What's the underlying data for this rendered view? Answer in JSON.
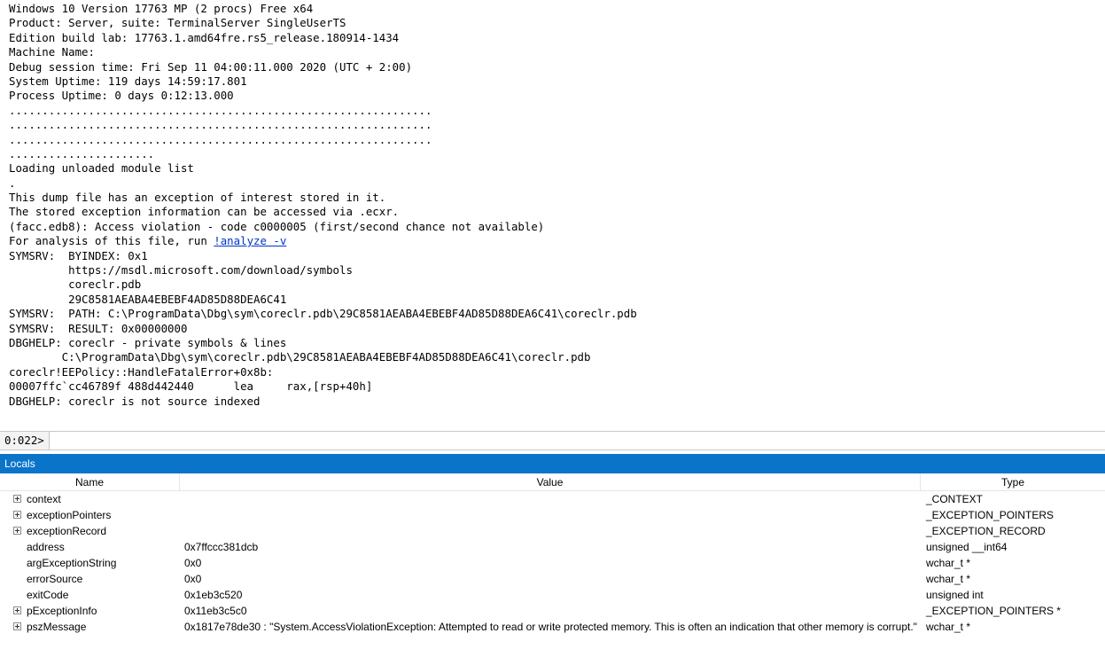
{
  "console": {
    "lines": [
      {
        "t": "Windows 10 Version 17763 MP (2 procs) Free x64"
      },
      {
        "t": "Product: Server, suite: TerminalServer SingleUserTS"
      },
      {
        "t": "Edition build lab: 17763.1.amd64fre.rs5_release.180914-1434"
      },
      {
        "t": "Machine Name:"
      },
      {
        "t": "Debug session time: Fri Sep 11 04:00:11.000 2020 (UTC + 2:00)"
      },
      {
        "t": "System Uptime: 119 days 14:59:17.801"
      },
      {
        "t": "Process Uptime: 0 days 0:12:13.000"
      },
      {
        "t": "................................................................"
      },
      {
        "t": "................................................................"
      },
      {
        "t": "................................................................"
      },
      {
        "t": "......................"
      },
      {
        "t": "Loading unloaded module list"
      },
      {
        "t": "."
      },
      {
        "t": "This dump file has an exception of interest stored in it."
      },
      {
        "t": "The stored exception information can be accessed via .ecxr."
      },
      {
        "t": "(facc.edb8): Access violation - code c0000005 (first/second chance not available)"
      },
      {
        "t": "For analysis of this file, run ",
        "link": "!analyze -v"
      },
      {
        "t": "SYMSRV:  BYINDEX: 0x1"
      },
      {
        "t": "         https://msdl.microsoft.com/download/symbols"
      },
      {
        "t": "         coreclr.pdb"
      },
      {
        "t": "         29C8581AEABA4EBEBF4AD85D88DEA6C41"
      },
      {
        "t": "SYMSRV:  PATH: C:\\ProgramData\\Dbg\\sym\\coreclr.pdb\\29C8581AEABA4EBEBF4AD85D88DEA6C41\\coreclr.pdb"
      },
      {
        "t": "SYMSRV:  RESULT: 0x00000000"
      },
      {
        "t": "DBGHELP: coreclr - private symbols & lines"
      },
      {
        "t": "        C:\\ProgramData\\Dbg\\sym\\coreclr.pdb\\29C8581AEABA4EBEBF4AD85D88DEA6C41\\coreclr.pdb"
      },
      {
        "t": "coreclr!EEPolicy::HandleFatalError+0x8b:"
      },
      {
        "t": "00007ffc`cc46789f 488d442440      lea     rax,[rsp+40h]"
      },
      {
        "t": "DBGHELP: coreclr is not source indexed"
      }
    ]
  },
  "command": {
    "prompt": "0:022>",
    "value": ""
  },
  "locals": {
    "title": "Locals",
    "columns": {
      "name": "Name",
      "value": "Value",
      "type": "Type"
    },
    "rows": [
      {
        "name": "context",
        "value": "",
        "type": "_CONTEXT",
        "expandable": true
      },
      {
        "name": "exceptionPointers",
        "value": "",
        "type": "_EXCEPTION_POINTERS",
        "expandable": true
      },
      {
        "name": "exceptionRecord",
        "value": "",
        "type": "_EXCEPTION_RECORD",
        "expandable": true
      },
      {
        "name": "address",
        "value": "0x7ffccc381dcb",
        "type": "unsigned __int64",
        "expandable": false
      },
      {
        "name": "argExceptionString",
        "value": "0x0",
        "type": "wchar_t *",
        "expandable": false
      },
      {
        "name": "errorSource",
        "value": "0x0",
        "type": "wchar_t *",
        "expandable": false
      },
      {
        "name": "exitCode",
        "value": "0x1eb3c520",
        "type": "unsigned int",
        "expandable": false
      },
      {
        "name": "pExceptionInfo",
        "value": "0x11eb3c5c0",
        "type": "_EXCEPTION_POINTERS *",
        "expandable": true
      },
      {
        "name": "pszMessage",
        "value": "0x1817e78de30 : \"System.AccessViolationException: Attempted to read or write protected memory. This is often an indication that other memory is corrupt.\"",
        "type": "wchar_t *",
        "expandable": true
      }
    ]
  },
  "colors": {
    "titlebar": "#0a74c9",
    "link": "#0033cc"
  }
}
